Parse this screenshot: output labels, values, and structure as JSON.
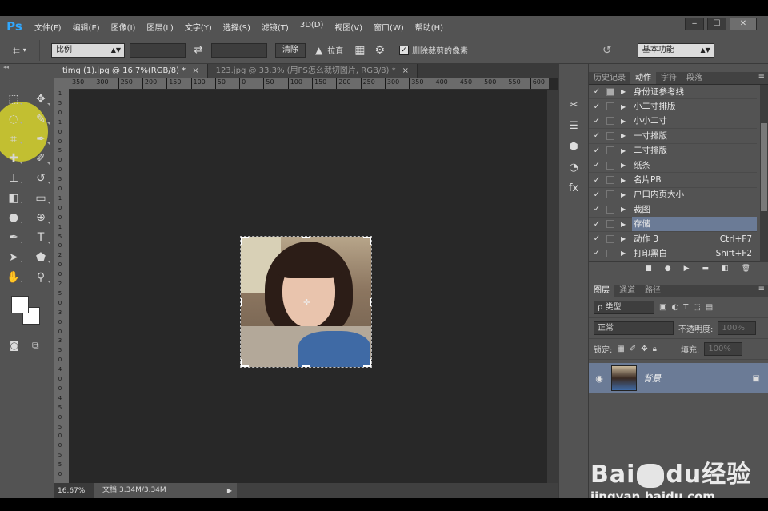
{
  "app": {
    "logo": "Ps",
    "menu": [
      "文件(F)",
      "编辑(E)",
      "图像(I)",
      "图层(L)",
      "文字(Y)",
      "选择(S)",
      "滤镜(T)",
      "3D(D)",
      "视图(V)",
      "窗口(W)",
      "帮助(H)"
    ],
    "window_controls": [
      "‒",
      "☐",
      "✕"
    ]
  },
  "options_bar": {
    "crop_icon": "crop-icon",
    "ratio_label": "比例",
    "swap_icon": "swap-icon",
    "clear_label": "清除",
    "straighten_label": "拉直",
    "grid_icon": "grid-icon",
    "settings_icon": "gear-icon",
    "delete_cropped_label": "删除裁剪的像素",
    "delete_cropped_checked": true,
    "undo_icon": "undo-icon",
    "workspace": "基本功能"
  },
  "tools": [
    {
      "name": "marquee-tool",
      "glyph": "⬚"
    },
    {
      "name": "move-tool",
      "glyph": "✥"
    },
    {
      "name": "lasso-tool",
      "glyph": "◌"
    },
    {
      "name": "quick-select-tool",
      "glyph": "✎"
    },
    {
      "name": "crop-tool",
      "glyph": "⌗"
    },
    {
      "name": "eyedropper-tool",
      "glyph": "✒"
    },
    {
      "name": "healing-tool",
      "glyph": "✚"
    },
    {
      "name": "brush-tool",
      "glyph": "✐"
    },
    {
      "name": "stamp-tool",
      "glyph": "⊥"
    },
    {
      "name": "history-brush-tool",
      "glyph": "↺"
    },
    {
      "name": "eraser-tool",
      "glyph": "◧"
    },
    {
      "name": "gradient-tool",
      "glyph": "▭"
    },
    {
      "name": "blur-tool",
      "glyph": "●"
    },
    {
      "name": "dodge-tool",
      "glyph": "⊕"
    },
    {
      "name": "pen-tool",
      "glyph": "✒"
    },
    {
      "name": "type-tool",
      "glyph": "T"
    },
    {
      "name": "path-select-tool",
      "glyph": "➤"
    },
    {
      "name": "shape-tool",
      "glyph": "⬟"
    },
    {
      "name": "hand-tool",
      "glyph": "✋"
    },
    {
      "name": "zoom-tool",
      "glyph": "⚲"
    }
  ],
  "documents": {
    "tabs": [
      {
        "label": "timg (1).jpg @ 16.7%(RGB/8) *",
        "active": true
      },
      {
        "label": "123.jpg @ 33.3% (用PS怎么裁切图片, RGB/8) *",
        "active": false
      }
    ],
    "ruler_h": [
      "350",
      "300",
      "250",
      "200",
      "150",
      "100",
      "50",
      "0",
      "50",
      "100",
      "150",
      "200",
      "250",
      "300",
      "350",
      "400",
      "450",
      "500",
      "550",
      "600"
    ],
    "ruler_v": [
      "1",
      "5",
      "0",
      "1",
      "0",
      "0",
      "5",
      "0",
      "0",
      "5",
      "0",
      "1",
      "0",
      "0",
      "1",
      "5",
      "0",
      "2",
      "0",
      "0",
      "2",
      "5",
      "0",
      "3",
      "0",
      "0",
      "3",
      "5",
      "0",
      "4",
      "0",
      "0",
      "4",
      "5",
      "0",
      "5",
      "0",
      "0",
      "5",
      "5",
      "0"
    ],
    "zoom": "16.67%",
    "doc_info": "文档:3.34M/3.34M"
  },
  "right_icons": [
    "brush-presets-icon",
    "adjust-icon",
    "cube-icon",
    "color-wheel-icon",
    "fx-icon"
  ],
  "actions_panel": {
    "tabs": [
      "历史记录",
      "动作",
      "字符",
      "段落"
    ],
    "active_tab": 1,
    "actions": [
      {
        "name": "身份证参考线",
        "shortcut": "",
        "dlg": true,
        "selected": false
      },
      {
        "name": "小二寸排版",
        "shortcut": "",
        "dlg": false,
        "selected": false
      },
      {
        "name": "小小二寸",
        "shortcut": "",
        "dlg": false,
        "selected": false
      },
      {
        "name": "一寸排版",
        "shortcut": "",
        "dlg": false,
        "selected": false
      },
      {
        "name": "二寸排版",
        "shortcut": "",
        "dlg": false,
        "selected": false
      },
      {
        "name": "纸条",
        "shortcut": "",
        "dlg": false,
        "selected": false
      },
      {
        "name": "名片PB",
        "shortcut": "",
        "dlg": false,
        "selected": false
      },
      {
        "name": "户口内页大小",
        "shortcut": "",
        "dlg": false,
        "selected": false
      },
      {
        "name": "裁图",
        "shortcut": "",
        "dlg": false,
        "selected": false
      },
      {
        "name": "存储",
        "shortcut": "",
        "dlg": false,
        "selected": true
      },
      {
        "name": "动作 3",
        "shortcut": "Ctrl+F7",
        "dlg": false,
        "selected": false
      },
      {
        "name": "打印黑白",
        "shortcut": "Shift+F2",
        "dlg": false,
        "selected": false
      }
    ],
    "footer_icons": [
      "stop-icon",
      "record-icon",
      "play-icon",
      "folder-icon",
      "new-action-icon",
      "trash-icon"
    ]
  },
  "layers_panel": {
    "tabs": [
      "图层",
      "通道",
      "路径"
    ],
    "filter_label": "ρ 类型",
    "blend_mode": "正常",
    "opacity_label": "不透明度:",
    "opacity_value": "100%",
    "lock_label": "锁定:",
    "fill_label": "填充:",
    "fill_value": "100%",
    "layers": [
      {
        "name": "背景",
        "locked": true,
        "visible": true
      }
    ]
  },
  "watermark": {
    "brand": "Bai",
    "brand2": "du",
    "suffix": "经验",
    "url": "jingyan.baidu.com"
  }
}
